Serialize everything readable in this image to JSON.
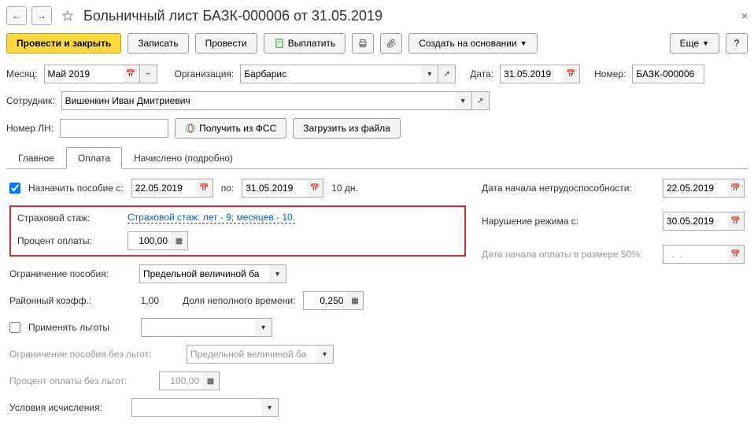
{
  "title": "Больничный лист БАЗК-000006 от 31.05.2019",
  "nav": {
    "back": "←",
    "forward": "→"
  },
  "toolbar": {
    "post_close": "Провести и закрыть",
    "save": "Записать",
    "post": "Провести",
    "pay": "Выплатить",
    "create_based": "Создать на основании",
    "more": "Еще"
  },
  "header": {
    "month_label": "Месяц:",
    "month": "Май 2019",
    "org_label": "Организация:",
    "org": "Барбарис",
    "date_label": "Дата:",
    "date": "31.05.2019",
    "number_label": "Номер:",
    "number": "БАЗК-000006",
    "employee_label": "Сотрудник:",
    "employee": "Вишенкин Иван Дмитриевич",
    "ln_label": "Номер ЛН:",
    "ln": "",
    "get_fss": "Получить из ФСС",
    "load_file": "Загрузить из файла"
  },
  "tabs": {
    "main": "Главное",
    "payment": "Оплата",
    "accrued": "Начислено (подробно)"
  },
  "payment": {
    "assign_from": "Назначить пособие с:",
    "date_from": "22.05.2019",
    "to": "по:",
    "date_to": "31.05.2019",
    "days": "10 дн.",
    "disability_start_label": "Дата начала нетрудоспособности:",
    "disability_start": "22.05.2019",
    "seniority_label": "Страховой стаж:",
    "seniority_link": "Страховой стаж: лет - 9; месяцев - 10.",
    "violation_label": "Нарушение режима с:",
    "violation_date": "30.05.2019",
    "percent_label": "Процент оплаты:",
    "percent": "100,00",
    "fifty_percent_label": "Дата начала оплаты в размере 50%:",
    "fifty_percent_date": "  .  .",
    "limit_label": "Ограничение пособия:",
    "limit_value": "Предельной величиной ба",
    "district_label": "Районный коэфф.:",
    "district_value": "1,00",
    "parttime_label": "Доля неполного времени:",
    "parttime_value": "0,250",
    "benefits_label": "Применять льготы",
    "limit_no_benefits_label": "Ограничение пособия без льгот:",
    "limit_no_benefits_value": "Предельной величиной ба",
    "percent_no_benefits_label": "Процент оплаты без льгот:",
    "percent_no_benefits_value": "100,00",
    "calc_conditions_label": "Условия исчисления:"
  }
}
